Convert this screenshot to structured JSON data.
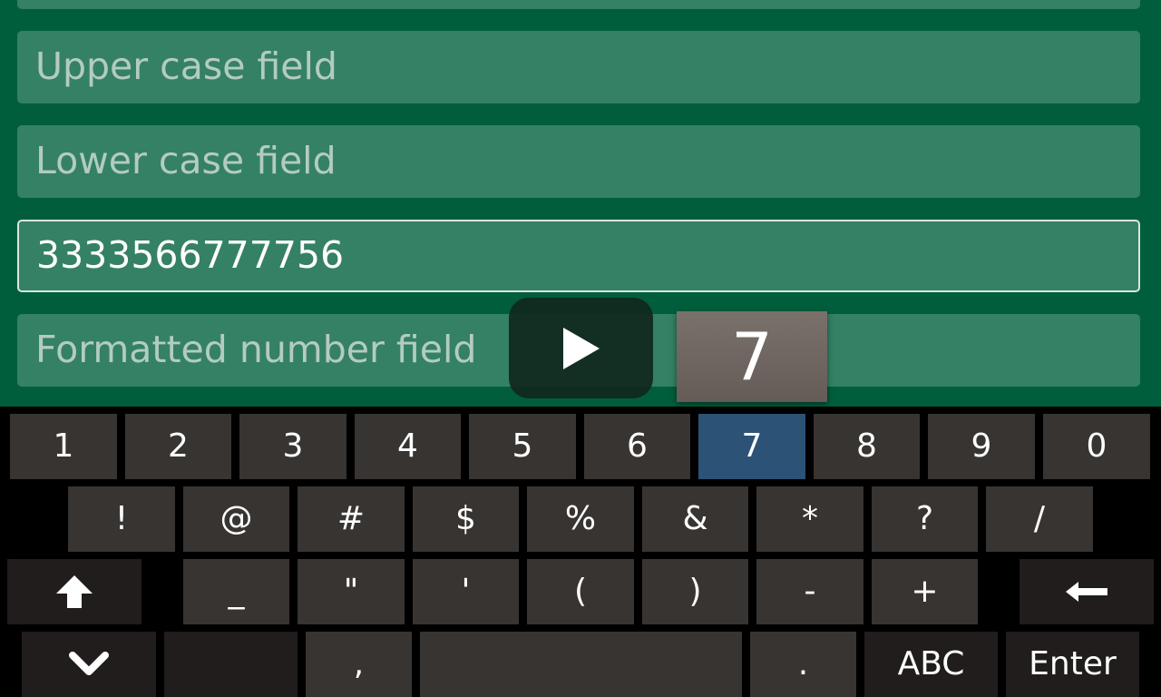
{
  "form": {
    "upper_placeholder": "Upper case field",
    "lower_placeholder": "Lower case field",
    "number_value": "3333566777756",
    "formatted_placeholder": "Formatted number field"
  },
  "key_preview": "7",
  "keyboard": {
    "row1": [
      "1",
      "2",
      "3",
      "4",
      "5",
      "6",
      "7",
      "8",
      "9",
      "0"
    ],
    "row2": [
      "!",
      "@",
      "#",
      "$",
      "%",
      "&",
      "*",
      "?",
      "/"
    ],
    "row3": [
      "_",
      "\"",
      "'",
      "(",
      ")",
      "-",
      "+"
    ],
    "comma": ",",
    "period": ".",
    "abc": "ABC",
    "enter": "Enter",
    "highlighted_key": "7"
  },
  "colors": {
    "background": "#005e3c",
    "field": "#358165",
    "key": "#383431",
    "key_highlight": "#2c5276"
  },
  "icons": [
    "play-icon",
    "shift-arrow-up-icon",
    "backspace-arrow-icon",
    "hide-keyboard-chevron-down-icon"
  ]
}
